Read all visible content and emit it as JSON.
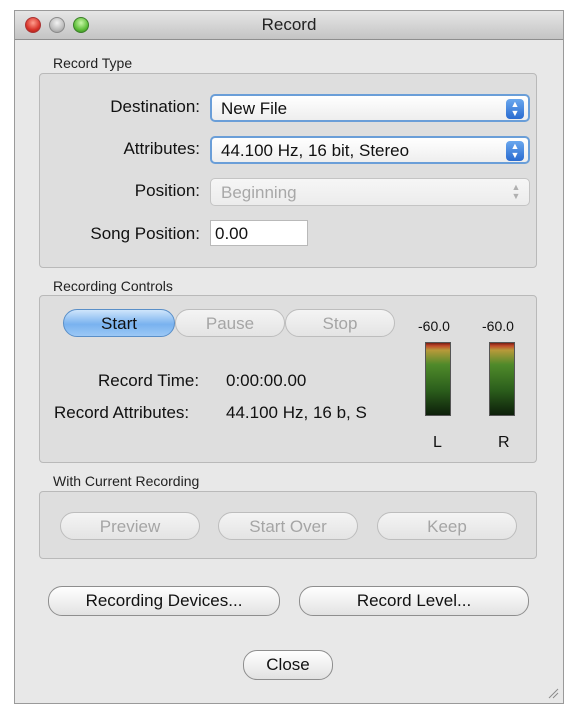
{
  "window": {
    "title": "Record"
  },
  "record_type": {
    "label": "Record Type",
    "destination": {
      "label": "Destination:",
      "value": "New File"
    },
    "attributes": {
      "label": "Attributes:",
      "value": "44.100 Hz, 16 bit, Stereo"
    },
    "position": {
      "label": "Position:",
      "value": "Beginning"
    },
    "song_position": {
      "label": "Song Position:",
      "value": "0.00"
    }
  },
  "recording_controls": {
    "label": "Recording Controls",
    "start": "Start",
    "pause": "Pause",
    "stop": "Stop",
    "record_time": {
      "label": "Record Time:",
      "value": "0:00:00.00"
    },
    "record_attributes": {
      "label": "Record Attributes:",
      "value": "44.100 Hz, 16 b, S"
    },
    "meters": [
      {
        "value": "-60.0",
        "channel": "L"
      },
      {
        "value": "-60.0",
        "channel": "R"
      }
    ]
  },
  "current_recording": {
    "label": "With Current Recording",
    "preview": "Preview",
    "start_over": "Start Over",
    "keep": "Keep"
  },
  "footer": {
    "recording_devices": "Recording Devices...",
    "record_level": "Record Level...",
    "close": "Close"
  },
  "colors": {
    "accent": "#79b2ef",
    "window_bg": "#e8e8e8"
  }
}
